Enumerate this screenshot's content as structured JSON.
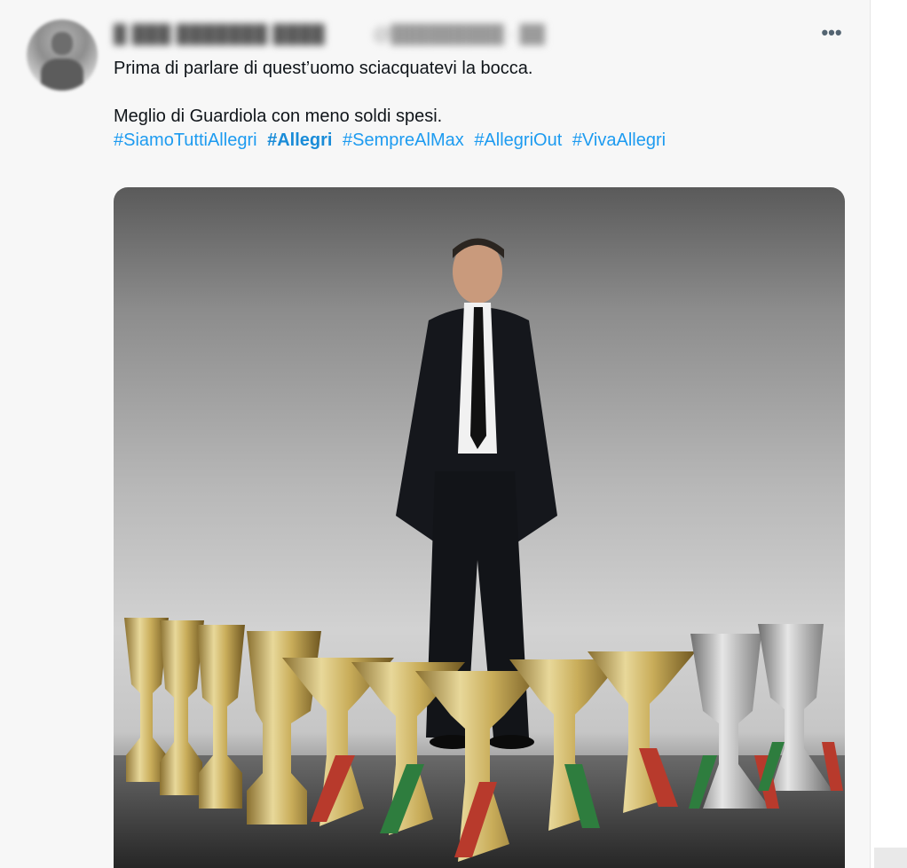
{
  "tweet": {
    "user_name": "█ ███ ███████ ████",
    "user_handle": "@█████████ · ██",
    "more_label": "•••",
    "text_line_1": "Prima di parlare di quest’uomo sciacquatevi la bocca.",
    "text_line_2": "Meglio di Guardiola con meno soldi spesi.",
    "hashtags": [
      "#SiamoTuttiAllegri",
      "#Allegri",
      "#SempreAlMax",
      "#AllegriOut",
      "#VivaAllegri"
    ]
  },
  "media": {
    "icon": "photo-man-with-trophies"
  },
  "colors": {
    "link": "#1d9bf0",
    "text": "#0f1419",
    "card_bg": "#f7f7f7"
  }
}
